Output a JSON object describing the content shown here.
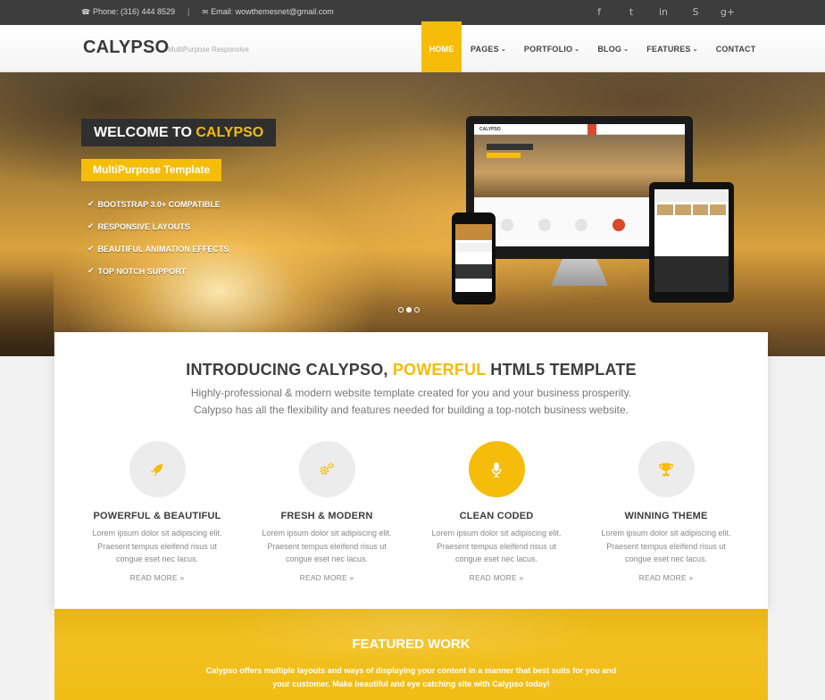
{
  "topbar": {
    "phone": "Phone: (316) 444 8529",
    "separator": "|",
    "email": "Email: wowthemesnet@gmail.com",
    "social": [
      "facebook-icon",
      "twitter-icon",
      "linkedin-icon",
      "skype-icon",
      "google-plus-icon"
    ],
    "social_glyphs": [
      "f",
      "t",
      "in",
      "S",
      "g+"
    ]
  },
  "header": {
    "logo": "CALYPSO",
    "tagline": "MultiPurpose Responsive",
    "nav": [
      {
        "label": "HOME",
        "active": true
      },
      {
        "label": "PAGES",
        "dropdown": true
      },
      {
        "label": "PORTFOLIO",
        "dropdown": true
      },
      {
        "label": "BLOG",
        "dropdown": true
      },
      {
        "label": "FEATURES",
        "dropdown": true
      },
      {
        "label": "CONTACT"
      }
    ]
  },
  "hero": {
    "welcome_prefix": "WELCOME TO",
    "welcome_highlight": "CALYPSO",
    "subtitle": "MultiPurpose Template",
    "features": [
      "BOOTSTRAP 3.0+ COMPATIBLE",
      "RESPONSIVE LAYOUTS",
      "BEAUTIFUL ANIMATION EFFECTS",
      "TOP NOTCH SUPPORT"
    ],
    "slider_dots": 3,
    "slider_active": 1
  },
  "intro": {
    "title_prefix": "INTRODUCING CALYPSO,",
    "title_highlight": "POWERFUL",
    "title_suffix": "HTML5 TEMPLATE",
    "line1": "Highly-professional & modern website template created for you and your business prosperity.",
    "line2": "Calypso has all the flexibility and features needed for building a top-notch business website."
  },
  "services": [
    {
      "icon": "rocket-icon",
      "title": "POWERFUL & BEAUTIFUL",
      "desc": "Lorem ipsum dolor sit adipiscing elit. Praesent tempus eleifend risus ut congue eset nec lacus.",
      "more": "READ MORE",
      "active": false
    },
    {
      "icon": "gears-icon",
      "title": "FRESH & MODERN",
      "desc": "Lorem ipsum dolor sit adipiscing elit. Praesent tempus eleifend risus ut congue eset nec lacus.",
      "more": "READ MORE",
      "active": false
    },
    {
      "icon": "microphone-icon",
      "title": "CLEAN CODED",
      "desc": "Lorem ipsum dolor sit adipiscing elit. Praesent tempus eleifend risus ut congue eset nec lacus.",
      "more": "READ MORE",
      "active": true
    },
    {
      "icon": "trophy-icon",
      "title": "WINNING THEME",
      "desc": "Lorem ipsum dolor sit adipiscing elit. Praesent tempus eleifend risus ut congue eset nec lacus.",
      "more": "READ MORE",
      "active": false
    }
  ],
  "featured": {
    "title": "FEATURED WORK",
    "line1": "Calypso offers multiple layouts and ways of displaying your content in a manner that best suits for you and",
    "line2": "your customer. Make beautiful and eye catching site with Calypso today!"
  },
  "colors": {
    "accent": "#f5bd0a",
    "dark": "#3d3d3d",
    "topbar": "#3d3d3d"
  }
}
